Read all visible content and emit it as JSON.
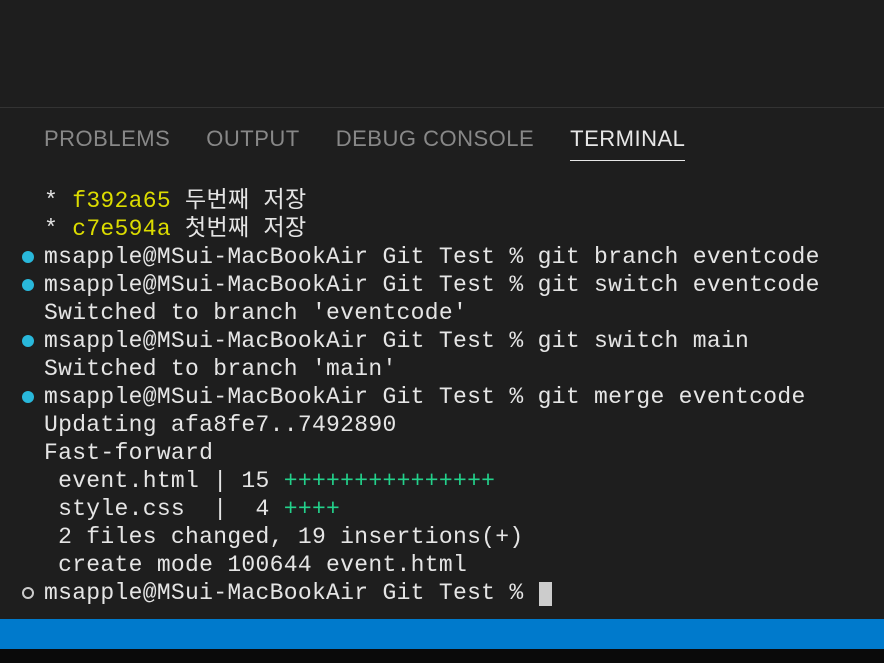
{
  "tabs": {
    "problems": "PROBLEMS",
    "output": "OUTPUT",
    "debug_console": "DEBUG CONSOLE",
    "terminal": "TERMINAL"
  },
  "terminal": {
    "log1_star": "*",
    "log1_hash": "f392a65",
    "log1_msg": "두번째 저장",
    "log2_star": "*",
    "log2_hash": "c7e594a",
    "log2_msg": "첫번째 저장",
    "prompt_user": "msapple@MSui-MacBookAir",
    "prompt_path": "Git Test",
    "prompt_suffix": "%",
    "cmd1": "git branch eventcode",
    "cmd2": "git switch eventcode",
    "out2": "Switched to branch 'eventcode'",
    "cmd3": "git switch main",
    "out3": "Switched to branch 'main'",
    "cmd4": "git merge eventcode",
    "out4a": "Updating afa8fe7..7492890",
    "out4b": "Fast-forward",
    "out4c_file": " event.html | 15 ",
    "out4c_plus": "+++++++++++++++",
    "out4d_file": " style.css  |  4 ",
    "out4d_plus": "++++",
    "out4e": " 2 files changed, 19 insertions(+)",
    "out4f": " create mode 100644 event.html"
  }
}
